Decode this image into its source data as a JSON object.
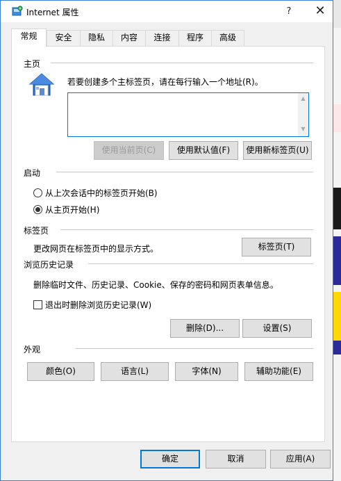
{
  "window": {
    "title": "Internet 属性",
    "help_label": "?",
    "close_label": "✕"
  },
  "tabs": [
    {
      "label": "常规",
      "active": true
    },
    {
      "label": "安全"
    },
    {
      "label": "隐私"
    },
    {
      "label": "内容"
    },
    {
      "label": "连接"
    },
    {
      "label": "程序"
    },
    {
      "label": "高级"
    }
  ],
  "homepage": {
    "group_label": "主页",
    "instruction": "若要创建多个主标签页，请在每行输入一个地址(R)。",
    "value": "",
    "btn_use_current": "使用当前页(C)",
    "btn_use_default": "使用默认值(F)",
    "btn_use_new_tab": "使用新标签页(U)"
  },
  "startup": {
    "group_label": "启动",
    "option_last_session": "从上次会话中的标签页开始(B)",
    "option_home_page": "从主页开始(H)",
    "selected": "home_page"
  },
  "tabs_group": {
    "group_label": "标签页",
    "description": "更改网页在标签页中的显示方式。",
    "button": "标签页(T)"
  },
  "history": {
    "group_label": "浏览历史记录",
    "description": "删除临时文件、历史记录、Cookie、保存的密码和网页表单信息。",
    "checkbox_label": "退出时删除浏览历史记录(W)",
    "checkbox_checked": false,
    "btn_delete": "删除(D)...",
    "btn_settings": "设置(S)"
  },
  "appearance": {
    "group_label": "外观",
    "btn_colors": "颜色(O)",
    "btn_languages": "语言(L)",
    "btn_fonts": "字体(N)",
    "btn_accessibility": "辅助功能(E)"
  },
  "footer": {
    "ok": "确定",
    "cancel": "取消",
    "apply": "应用(A)"
  },
  "colors": {
    "accent": "#0078d7",
    "window_border": "#3c7fd0"
  }
}
